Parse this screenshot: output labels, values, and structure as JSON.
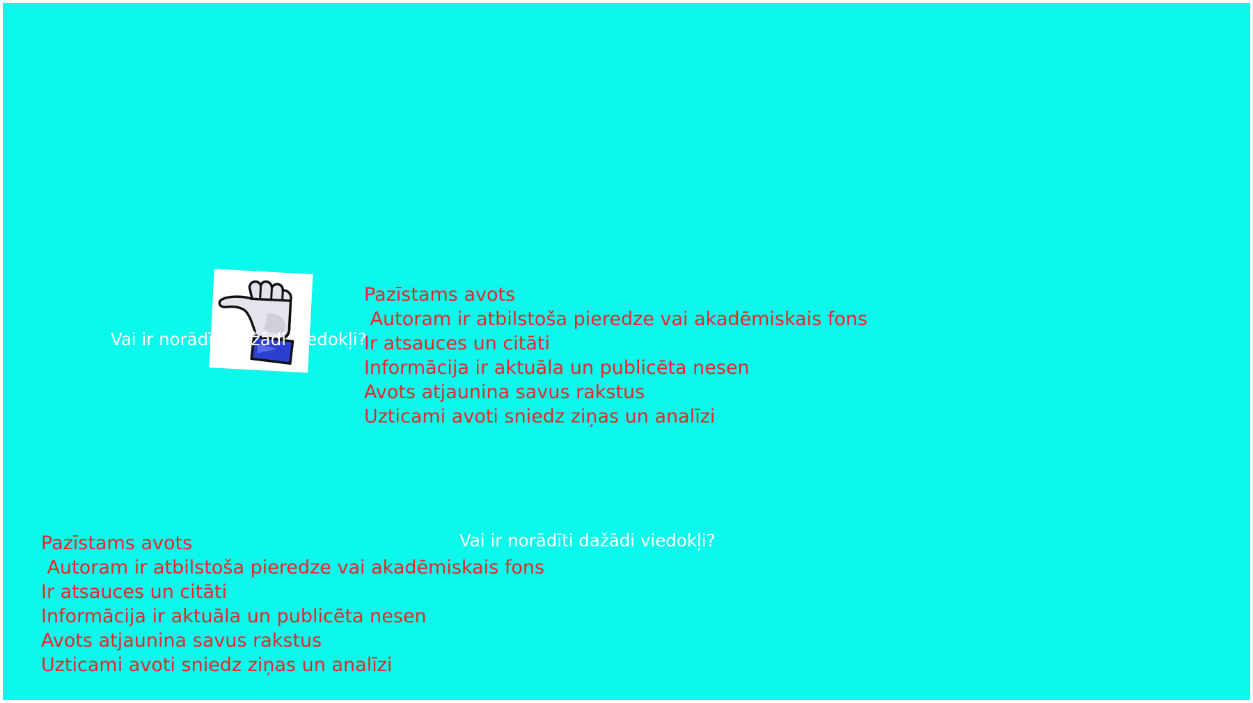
{
  "questions": {
    "top": "Vai ir norādīti dažādi viedokļi?",
    "bottom": "Vai ir norādīti dažādi viedokļi?"
  },
  "criteria_top": [
    "Pazīstams avots",
    " Autoram ir atbilstoša pieredze vai akadēmiskais fons",
    "Ir atsauces un citāti",
    "Informācija ir aktuāla un publicēta nesen",
    "Avots atjaunina savus rakstus",
    "Uzticami avoti sniedz ziņas un analīzi"
  ],
  "criteria_bottom": [
    "Pazīstams avots",
    " Autoram ir atbilstoša pieredze vai akadēmiskais fons",
    "Ir atsauces un citāti",
    "Informācija ir aktuāla un publicēta nesen",
    "Avots atjaunina savus rakstus",
    "Uzticami avoti sniedz ziņas un analīzi"
  ],
  "colors": {
    "background": "#0bf8ec",
    "criteria_text": "#e8262b",
    "question_text": "#ffffff",
    "cuff": "#2b3fd0"
  },
  "icons": {
    "thumb": "thumbs-down-icon"
  }
}
